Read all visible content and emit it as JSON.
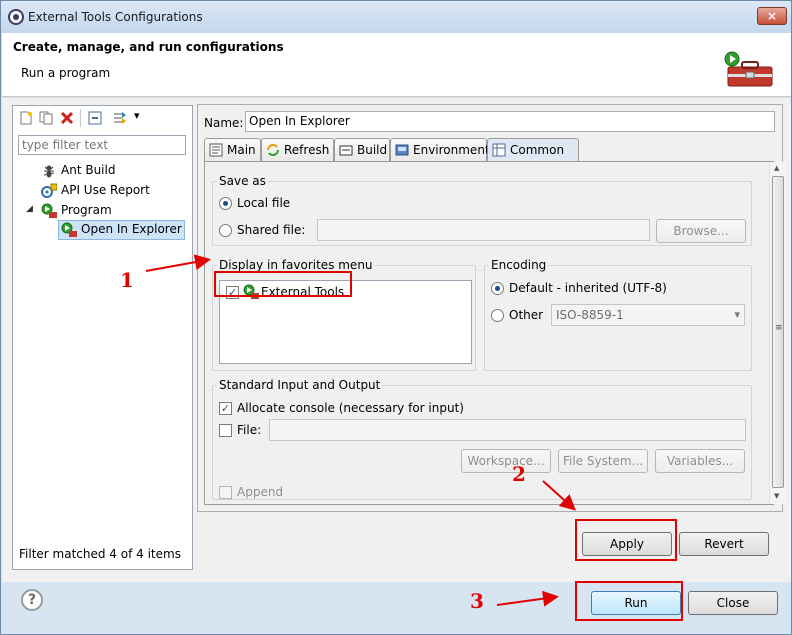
{
  "window": {
    "title": "External Tools Configurations",
    "close_glyph": "×"
  },
  "header": {
    "title": "Create, manage, and run configurations",
    "subtitle": "Run a program"
  },
  "left": {
    "filter_placeholder": "type filter text",
    "tree": [
      {
        "label": "Ant Build",
        "icon": "ant-icon"
      },
      {
        "label": "API Use Report",
        "icon": "api-report-icon"
      },
      {
        "label": "Program",
        "icon": "program-icon",
        "expanded": true
      },
      {
        "label": "Open In Explorer",
        "icon": "program-launch-icon",
        "selected": true
      }
    ],
    "status": "Filter matched 4 of 4 items",
    "toolbar_dropdown_glyph": "▾",
    "tree_expand_glyph": "◢"
  },
  "config": {
    "name_label": "Name:",
    "name_value": "Open In Explorer",
    "tabs": [
      {
        "label": "Main",
        "icon": "main-tab-icon"
      },
      {
        "label": "Refresh",
        "icon": "refresh-icon"
      },
      {
        "label": "Build",
        "icon": "build-icon"
      },
      {
        "label": "Environment",
        "icon": "environment-icon"
      },
      {
        "label": "Common",
        "icon": "common-icon",
        "active": true
      }
    ],
    "save_as": {
      "title": "Save as",
      "local_file": "Local file",
      "shared_file": "Shared file:",
      "browse": "Browse..."
    },
    "favorites": {
      "title": "Display in favorites menu",
      "items": [
        "External Tools"
      ]
    },
    "encoding": {
      "title": "Encoding",
      "default": "Default - inherited (UTF-8)",
      "other": "Other",
      "other_value": "ISO-8859-1"
    },
    "stdio": {
      "title": "Standard Input and Output",
      "allocate": "Allocate console (necessary for input)",
      "file": "File:",
      "workspace": "Workspace...",
      "file_system": "File System...",
      "variables": "Variables...",
      "append": "Append"
    },
    "check_glyph": "✓",
    "scroll_up_glyph": "▲",
    "scroll_down_glyph": "▼",
    "scroll_grip_glyph": "≡",
    "select_arrow_glyph": "▾"
  },
  "buttons": {
    "apply": "Apply",
    "revert": "Revert",
    "run": "Run",
    "close": "Close",
    "help": "?"
  },
  "annotations": {
    "one": "1",
    "two": "2",
    "three": "3"
  },
  "colors": {
    "annotation": "#e30000",
    "selection": "#cde4f7"
  }
}
